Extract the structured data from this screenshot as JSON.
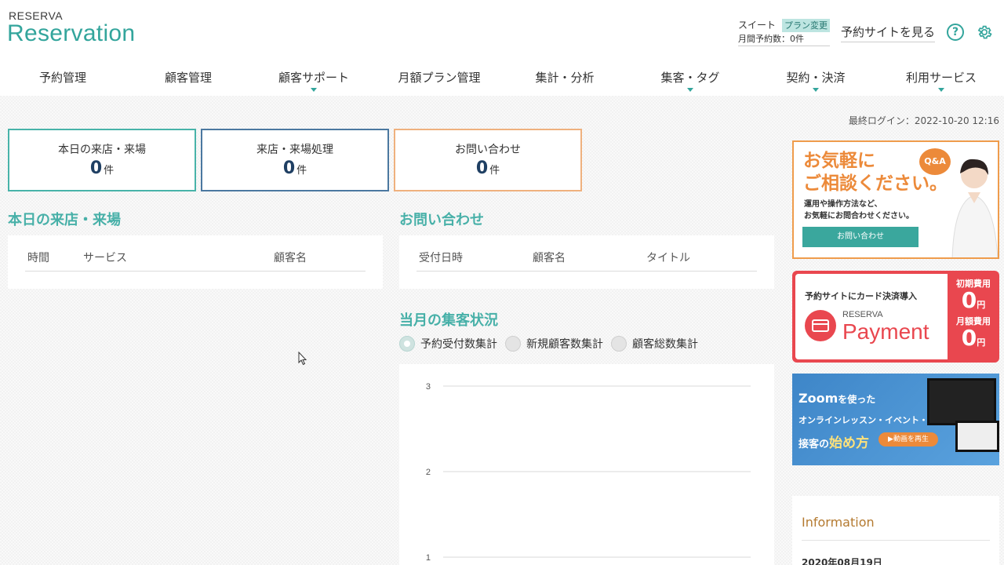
{
  "header": {
    "brand_small": "RESERVA",
    "brand_large": "Reservation",
    "plan_name": "スイート",
    "plan_change_label": "プラン変更",
    "plan_count": "月間予約数：0件",
    "view_site_label": "予約サイトを見る",
    "help_icon": "question-circle-icon",
    "settings_icon": "gear-icon",
    "help_glyph": "?"
  },
  "nav": {
    "items": [
      {
        "label": "予約管理",
        "has_dropdown": false
      },
      {
        "label": "顧客管理",
        "has_dropdown": false
      },
      {
        "label": "顧客サポート",
        "has_dropdown": true
      },
      {
        "label": "月額プラン管理",
        "has_dropdown": false
      },
      {
        "label": "集計・分析",
        "has_dropdown": false
      },
      {
        "label": "集客・タグ",
        "has_dropdown": true
      },
      {
        "label": "契約・決済",
        "has_dropdown": true
      },
      {
        "label": "利用サービス",
        "has_dropdown": true
      }
    ]
  },
  "last_login": "最終ログイン：2022-10-20 12:16",
  "stats": [
    {
      "label": "本日の来店・来場",
      "value": "0",
      "unit": "件"
    },
    {
      "label": "来店・来場処理",
      "value": "0",
      "unit": "件"
    },
    {
      "label": "お問い合わせ",
      "value": "0",
      "unit": "件"
    }
  ],
  "today_visits": {
    "title": "本日の来店・来場",
    "columns": [
      "時間",
      "サービス",
      "顧客名"
    ]
  },
  "inquiries": {
    "title": "お問い合わせ",
    "columns": [
      "受付日時",
      "顧客名",
      "タイトル"
    ]
  },
  "monthly": {
    "title": "当月の集客状況",
    "options": [
      "予約受付数集計",
      "新規顧客数集計",
      "顧客総数集計"
    ],
    "selected": "予約受付数集計"
  },
  "chart_data": {
    "type": "line",
    "categories": [],
    "series": [],
    "yticks": [
      "3",
      "2",
      "1"
    ],
    "ylim": [
      1,
      3
    ],
    "grid": true,
    "title": "",
    "xlabel": "",
    "ylabel": ""
  },
  "banners": {
    "qa": {
      "line1": "お気軽に",
      "line2": "ご相談ください。",
      "sub1": "運用や操作方法など、",
      "sub2": "お気軽にお問合わせください。",
      "button": "お問い合わせ",
      "badge": "Q&A"
    },
    "payment": {
      "title": "予約サイトにカード決済導入",
      "brand_small": "RESERVA",
      "brand_large": "Payment",
      "initial_label": "初期費用",
      "monthly_label": "月額費用",
      "zero": "0",
      "yen": "円"
    },
    "zoom": {
      "t1a": "Zoom",
      "t1b": "を使った",
      "t2": "オンラインレッスン・イベント・",
      "t3a": "接客の",
      "t3b": "始め方",
      "play": "▶動画を再生"
    }
  },
  "information": {
    "title": "Information",
    "date": "2020年08月19日"
  }
}
